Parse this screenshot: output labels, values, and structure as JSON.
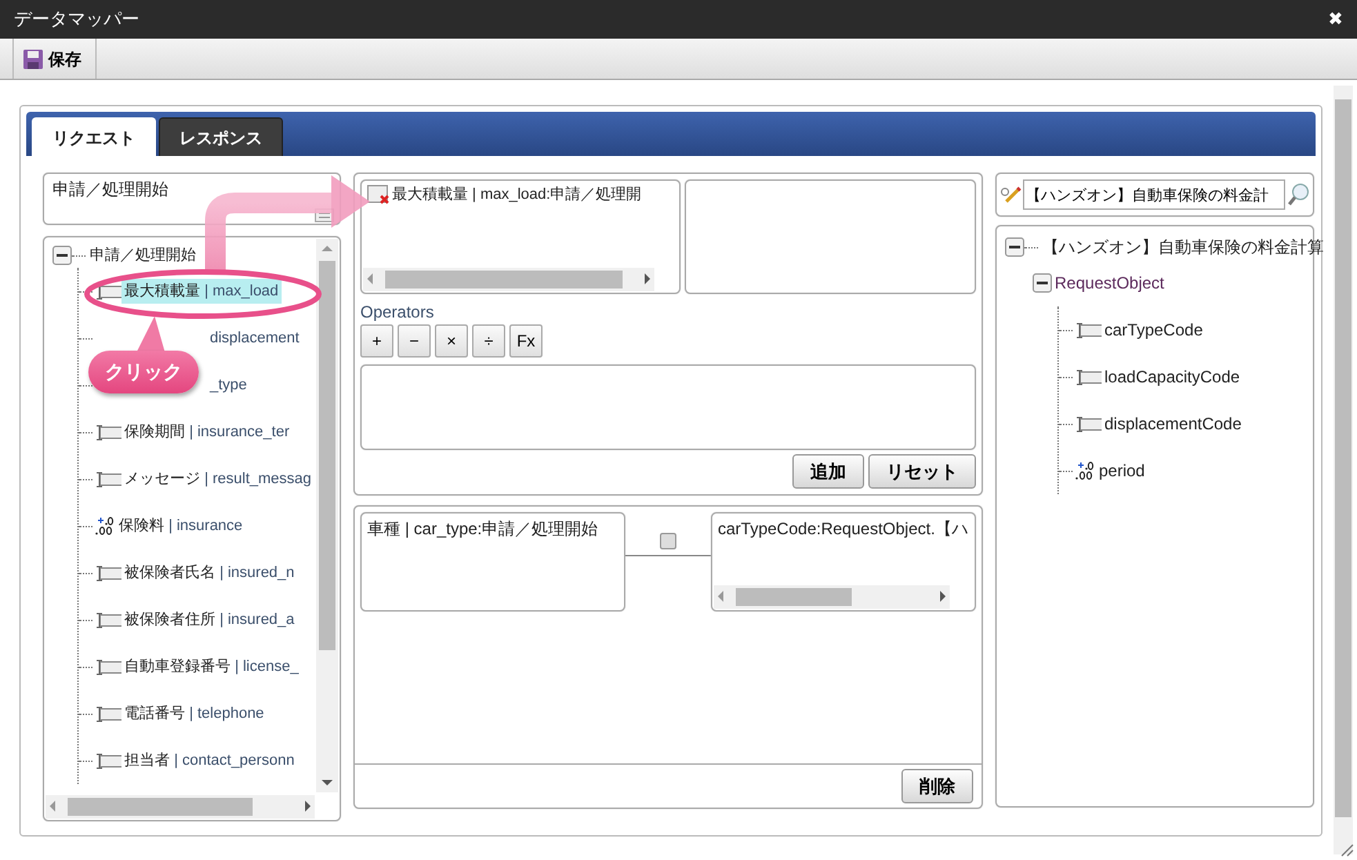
{
  "window": {
    "title": "データマッパー",
    "close": "✖"
  },
  "toolbar": {
    "save_button": "保存"
  },
  "tabs": [
    {
      "label": "リクエスト",
      "selected": true
    },
    {
      "label": "レスポンス",
      "selected": false
    }
  ],
  "source": {
    "select_value": "申請／処理開始",
    "tree": {
      "label": "申請／処理開始",
      "expanded": true,
      "children": [
        {
          "kind": "string",
          "label": "最大積載量",
          "field": "| max_load",
          "selected": true
        },
        {
          "field": "displacement",
          "selected": false
        },
        {
          "field": "_type",
          "selected": false
        },
        {
          "kind": "string",
          "label": "保険期間",
          "field": "| insurance_ter",
          "selected": false
        },
        {
          "kind": "string",
          "label": "メッセージ",
          "field": "| result_messag",
          "selected": false
        },
        {
          "kind": "number",
          "label": "保険料",
          "field": "| insurance",
          "selected": false
        },
        {
          "kind": "string",
          "label": "被保険者氏名",
          "field": "| insured_n",
          "selected": false
        },
        {
          "kind": "string",
          "label": "被保険者住所",
          "field": "| insured_a",
          "selected": false
        },
        {
          "kind": "string",
          "label": "自動車登録番号",
          "field": "| license_",
          "selected": false
        },
        {
          "kind": "string",
          "label": "電話番号",
          "field": "| telephone",
          "selected": false
        },
        {
          "kind": "string",
          "label": "担当者",
          "field": "| contact_personn",
          "selected": false
        }
      ]
    }
  },
  "annotation": {
    "callout": "クリック"
  },
  "editor": {
    "source_item": "最大積載量 | max_load:申請／処理開",
    "operators_label": "Operators",
    "operators": [
      "+",
      "−",
      "×",
      "÷",
      "Fx"
    ],
    "buttons": [
      "追加",
      "リセット"
    ]
  },
  "mappings": [
    {
      "source": "車種 | car_type:申請／処理開始",
      "target": "carTypeCode:RequestObject.【ハ",
      "checked": false
    }
  ],
  "delete_button": "削除",
  "target": {
    "search_value": "【ハンズオン】自動車保険の料金計",
    "tree": {
      "label": "【ハンズオン】自動車保険の料金計算",
      "expanded": true,
      "children": [
        {
          "kind": "object",
          "label": "RequestObject",
          "expanded": true,
          "children": [
            {
              "kind": "string",
              "label": "carTypeCode"
            },
            {
              "kind": "string",
              "label": "loadCapacityCode"
            },
            {
              "kind": "string",
              "label": "displacementCode"
            },
            {
              "kind": "number",
              "label": "period"
            }
          ]
        }
      ]
    }
  }
}
